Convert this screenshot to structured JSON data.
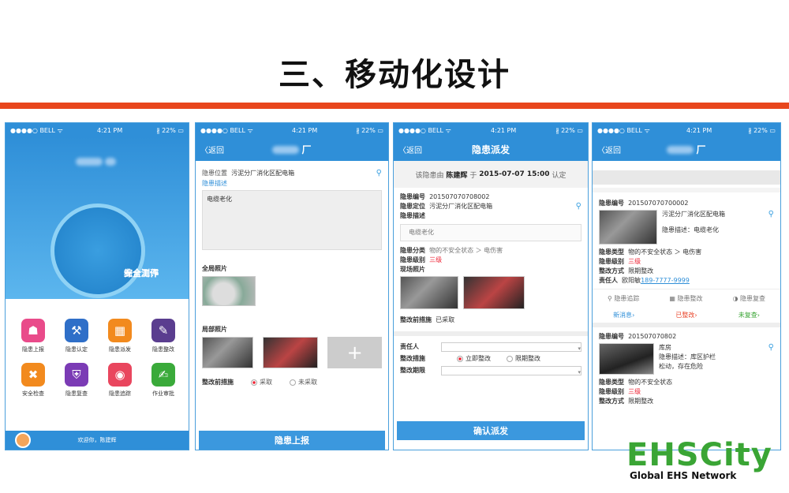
{
  "title": "三、移动化设计",
  "status": {
    "carrier": "●●●●○ BELL ᯤ",
    "time": "4:21 PM",
    "battery": "∦ 22% ▭"
  },
  "phone1": {
    "center_line1": "安全工作",
    "center_line2": "综合测评",
    "tiles": [
      {
        "label": "隐患上报",
        "color": "#e94b8a",
        "icon": "megaphone-icon"
      },
      {
        "label": "隐患认定",
        "color": "#2f6fc8",
        "icon": "gavel-icon"
      },
      {
        "label": "隐患派发",
        "color": "#f28a1e",
        "icon": "calculator-icon"
      },
      {
        "label": "隐患整改",
        "color": "#5a3d8f",
        "icon": "tools-icon"
      },
      {
        "label": "安全检查",
        "color": "#f28a1e",
        "icon": "wrench-icon"
      },
      {
        "label": "隐患复查",
        "color": "#7b3bb5",
        "icon": "shield-icon"
      },
      {
        "label": "隐患追踪",
        "color": "#e9465e",
        "icon": "location-icon"
      },
      {
        "label": "作业审批",
        "color": "#3aaa3a",
        "icon": "edit-icon"
      }
    ],
    "welcome": "欢迎你，陈建辉"
  },
  "phone2": {
    "back": "〈返回",
    "title_suffix": "厂",
    "location_label": "隐患位置",
    "location_value": "污泥分厂消化区配电箱",
    "desc_label": "隐患描述",
    "desc_value": "电缆老化",
    "full_photo_label": "全局照片",
    "local_photo_label": "局部照片",
    "measure_label": "整改前措施",
    "opt_taken": "采取",
    "opt_not_taken": "未采取",
    "submit": "隐患上报"
  },
  "phone3": {
    "back": "〈返回",
    "title": "隐患派发",
    "confirm_prefix": "该隐患由",
    "confirm_person": "陈建辉",
    "confirm_mid": "于",
    "confirm_time": "2015-07-07 15:00",
    "confirm_suffix": "认定",
    "id_label": "隐患编号",
    "id_value": "201507070708002",
    "loc_label": "隐患定位",
    "loc_value": "污泥分厂消化区配电箱",
    "desc_label": "隐患描述",
    "desc_value": "电缆老化",
    "cat_label": "隐患分类",
    "cat_value": "物的不安全状态 ＞ 电伤害",
    "level_label": "隐患级别",
    "level_value": "三级",
    "photo_label": "现场照片",
    "pre_label": "整改前措施",
    "pre_value": "已采取",
    "owner_label": "责任人",
    "rect_label": "整改措施",
    "rect_opt1": "立即整改",
    "rect_opt2": "限期整改",
    "deadline_label": "整改期限",
    "confirm_btn": "确认派发"
  },
  "phone4": {
    "back": "〈返回",
    "title_suffix": "厂",
    "card1": {
      "id_label": "隐患编号",
      "id_value": "201507070700002",
      "loc": "污泥分厂消化区配电箱",
      "desc": "隐患描述：电缆老化",
      "type_label": "隐患类型",
      "type_value": "物的不安全状态 ＞ 电伤害",
      "level_label": "隐患级别",
      "level_value": "三级",
      "method_label": "整改方式",
      "method_value": "限期整改",
      "owner_label": "责任人",
      "owner_name": "欧阳敏",
      "owner_phone": "189-7777-9999"
    },
    "actions": [
      "隐患追踪",
      "隐患整改",
      "隐患复查"
    ],
    "statuses": [
      {
        "label": "新消息",
        "color": "#2f8fd8"
      },
      {
        "label": "已整改",
        "color": "#e9462b"
      },
      {
        "label": "未复查",
        "color": "#3aa535"
      }
    ],
    "card2": {
      "id_label": "隐患编号",
      "id_value": "201507070802",
      "loc": "库房",
      "desc_line1": "隐患描述：库区护栏",
      "desc_line2": "松动，存在危险",
      "type_label": "隐患类型",
      "type_value": "物的不安全状态",
      "level_label": "隐患级别",
      "level_value": "三级",
      "method_label": "整改方式",
      "method_value": "限期整改"
    }
  },
  "logo": {
    "name": "EHSCity",
    "tagline": "Global EHS Network"
  }
}
